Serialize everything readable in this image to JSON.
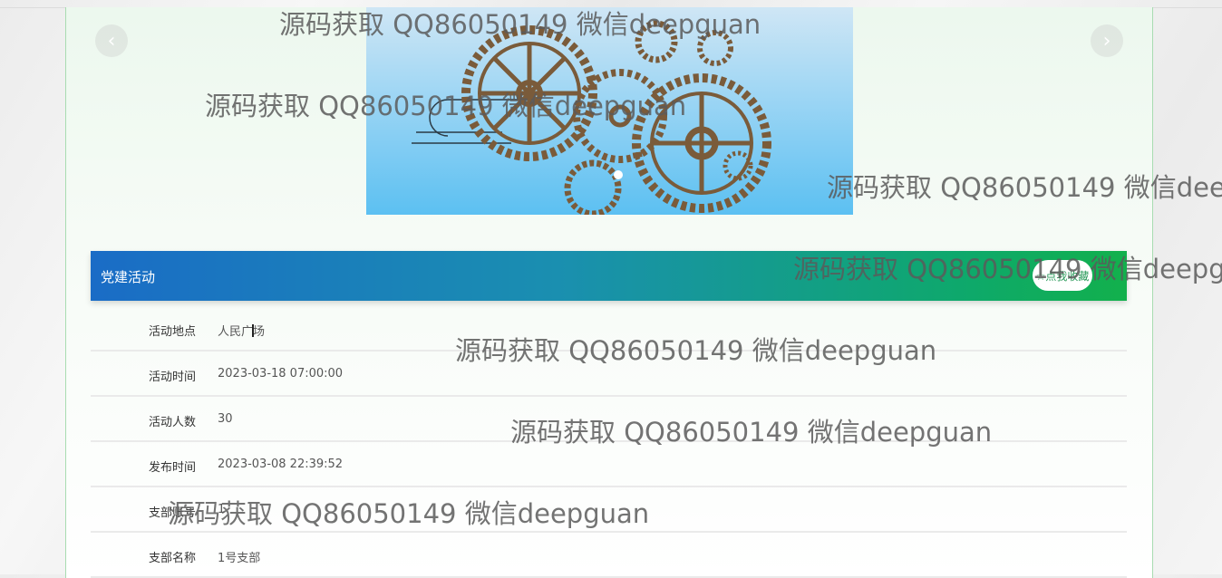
{
  "carousel": {
    "prev_icon": "‹",
    "next_icon": "›",
    "icons": {
      "prev": "chevron-left-icon",
      "next": "chevron-right-icon"
    }
  },
  "section": {
    "title": "党建活动",
    "favorite_button": "☆点我收藏"
  },
  "details": [
    {
      "label": "活动地点",
      "value": "人民广场"
    },
    {
      "label": "活动时间",
      "value": "2023-03-18 07:00:00"
    },
    {
      "label": "活动人数",
      "value": "30"
    },
    {
      "label": "发布时间",
      "value": "2023-03-08 22:39:52"
    },
    {
      "label": "支部账号",
      "value": "1"
    },
    {
      "label": "支部名称",
      "value": "1号支部"
    }
  ],
  "watermark_text": "源码获取 QQ86050149 微信deepguan",
  "colors": {
    "header_start": "#1a6cc6",
    "header_end": "#12b04c",
    "card_border": "#a8dcb1"
  }
}
